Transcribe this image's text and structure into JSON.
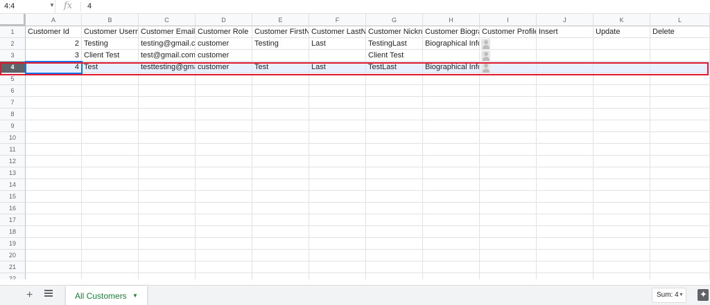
{
  "formula_bar": {
    "name_box": "4:4",
    "fx_symbol": "fx",
    "value": "4"
  },
  "columns": [
    "A",
    "B",
    "C",
    "D",
    "E",
    "F",
    "G",
    "H",
    "I",
    "J",
    "K",
    "L"
  ],
  "row_numbers": [
    "1",
    "2",
    "3",
    "4",
    "5",
    "6",
    "7",
    "8",
    "9",
    "10",
    "11",
    "12",
    "13",
    "14",
    "15",
    "16",
    "17",
    "18",
    "19",
    "20",
    "21",
    "22"
  ],
  "active_row": "4",
  "rows": [
    {
      "row": "1",
      "cells": [
        "Customer Id",
        "Customer Usern",
        "Customer Email",
        "Customer Role",
        "Customer FirstN",
        "Customer LastNa",
        "Customer Nickna",
        "Customer Biogra",
        "Customer Profile",
        "Insert",
        "Update",
        "Delete"
      ]
    },
    {
      "row": "2",
      "cells": [
        "2",
        "Testing",
        "testing@gmail.co",
        "customer",
        "Testing",
        "Last",
        "TestingLast",
        "Biographical Info",
        "",
        "",
        "",
        ""
      ]
    },
    {
      "row": "3",
      "cells": [
        "3",
        "Client Test",
        "test@gmail.com",
        "customer",
        "",
        "",
        "Client Test",
        "",
        "",
        "",
        "",
        ""
      ]
    },
    {
      "row": "4",
      "cells": [
        "4",
        "Test",
        "testtesting@gma",
        "customer",
        "Test",
        "Last",
        "TestLast",
        "Biographical Info",
        "",
        "",
        "",
        ""
      ]
    }
  ],
  "bottom_bar": {
    "add_icon": "plus-icon",
    "list_icon": "sheet-list-icon",
    "sheet_tab": "All Customers",
    "sum_label": "Sum: 4"
  },
  "colors": {
    "active_border": "#1a73e8",
    "highlight_box": "#e0182b",
    "selected_row_bg": "#e8f0fe",
    "tab_text": "#188038"
  }
}
